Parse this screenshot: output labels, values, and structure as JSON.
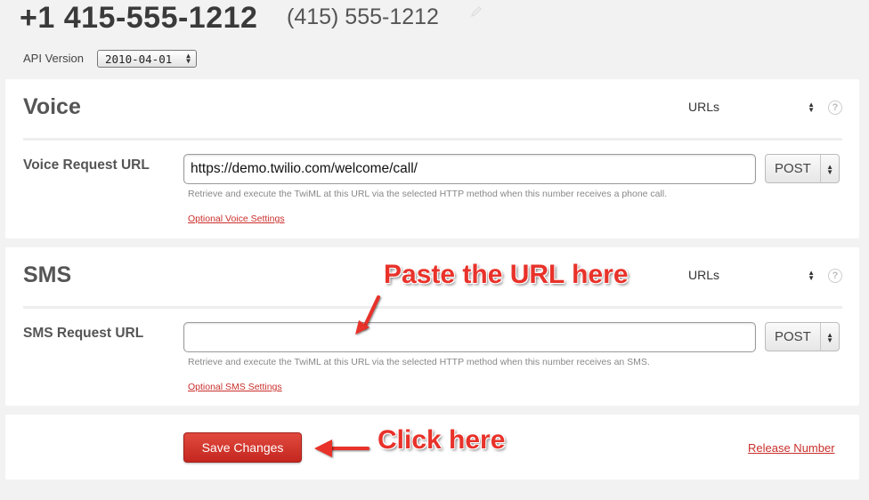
{
  "header": {
    "phone_e164": "+1 415-555-1212",
    "phone_local": "(415) 555-1212",
    "edit_icon": "pencil-icon",
    "api_version_label": "API Version",
    "api_version_value": "2010-04-01"
  },
  "voice": {
    "title": "Voice",
    "mode": "URLs",
    "field_label": "Voice Request URL",
    "url_value": "https://demo.twilio.com/welcome/call/",
    "method": "POST",
    "hint": "Retrieve and execute the TwiML at this URL via the selected HTTP method when this number receives a phone call.",
    "optional_link": "Optional Voice Settings"
  },
  "sms": {
    "title": "SMS",
    "mode": "URLs",
    "field_label": "SMS Request URL",
    "url_value": "",
    "method": "POST",
    "hint": "Retrieve and execute the TwiML at this URL via the selected HTTP method when this number receives an SMS.",
    "optional_link": "Optional SMS Settings"
  },
  "actions": {
    "save_label": "Save Changes",
    "release_label": "Release Number"
  },
  "annotations": {
    "paste": "Paste the URL here",
    "click": "Click here"
  },
  "colors": {
    "accent_red": "#c9302c",
    "annotation_red": "#e8322a",
    "background": "#f2f2f2"
  }
}
